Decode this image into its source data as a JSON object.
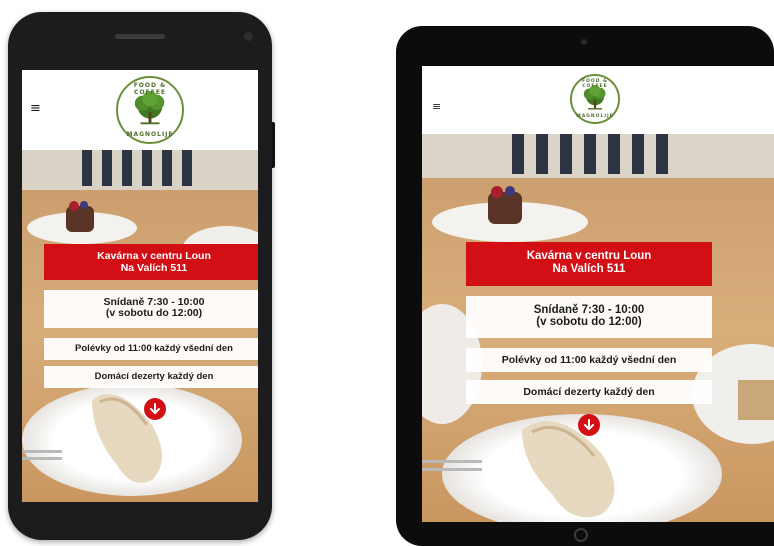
{
  "site": {
    "menu_icon": "≡",
    "logo": {
      "name": "tree-logo-icon",
      "top_text": "FOOD & COFFEE",
      "bottom_text": "MAGNOLIJE"
    },
    "banners": {
      "headline_line1": "Kavárna v centru Loun",
      "headline_line2": "Na Valích 511",
      "breakfast_line1": "Snídaně 7:30 - 10:00",
      "breakfast_line2": "(v sobotu do 12:00)",
      "soups": "Polévky od 11:00 každý všední den",
      "desserts": "Domácí dezerty každý den"
    },
    "scroll_icon": "arrow-down-icon"
  },
  "colors": {
    "accent_red": "#d30f16",
    "logo_green": "#6c8f3a",
    "device_black": "#1c1c1e"
  }
}
